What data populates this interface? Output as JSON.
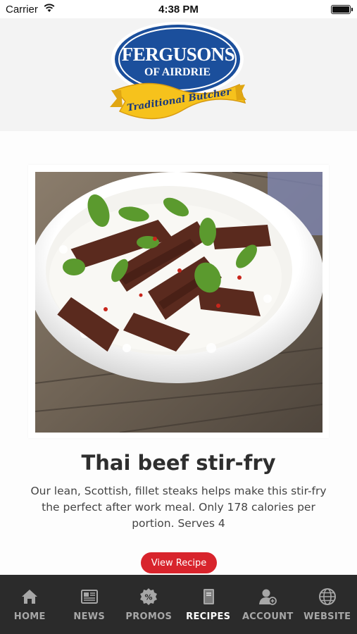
{
  "status_bar": {
    "carrier": "Carrier",
    "time": "4:38 PM",
    "battery_level": 1.0
  },
  "logo": {
    "line1": "FERGUSONS",
    "line2": "OF AIRDRIE",
    "ribbon": "Traditional Butcher",
    "colors": {
      "oval": "#1b4f9c",
      "oval_border": "#ffffff",
      "ribbon": "#f6c21c"
    }
  },
  "recipe": {
    "title": "Thai beef stir-fry",
    "description": "Our lean, Scottish, fillet steaks helps make this stir-fry the perfect after work meal. Only 178 calories per portion. Serves 4",
    "button_label": "View Recipe"
  },
  "colors": {
    "accent": "#d8242c",
    "tabbar_bg": "#2b2b2b",
    "tab_inactive": "#a7a7a7",
    "tab_active": "#ffffff"
  },
  "tabs": [
    {
      "label": "HOME",
      "icon": "home-icon",
      "active": false
    },
    {
      "label": "NEWS",
      "icon": "newspaper-icon",
      "active": false
    },
    {
      "label": "PROMOS",
      "icon": "percent-badge-icon",
      "active": false
    },
    {
      "label": "RECIPES",
      "icon": "recipe-book-icon",
      "active": true
    },
    {
      "label": "ACCOUNT",
      "icon": "account-icon",
      "active": false
    },
    {
      "label": "WEBSITE",
      "icon": "globe-icon",
      "active": false
    }
  ]
}
